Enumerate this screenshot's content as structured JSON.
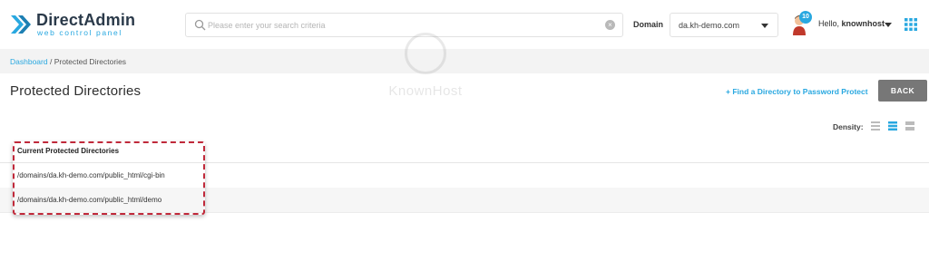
{
  "header": {
    "logo_title": "DirectAdmin",
    "logo_subtitle": "web control panel",
    "search_placeholder": "Please enter your search criteria",
    "domain_label": "Domain",
    "domain_value": "da.kh-demo.com",
    "notification_count": "10",
    "greeting": "Hello,",
    "username": "knownhost"
  },
  "breadcrumb": {
    "home": "Dashboard",
    "separator": " / ",
    "current": "Protected Directories"
  },
  "page": {
    "title": "Protected Directories",
    "find_link": "+ Find a Directory to Password Protect",
    "back_button": "BACK",
    "density_label": "Density:"
  },
  "table": {
    "header": "Current Protected Directories",
    "rows": [
      "/domains/da.kh-demo.com/public_html/cgi-bin",
      "/domains/da.kh-demo.com/public_html/demo"
    ]
  },
  "watermark": {
    "text": "KnownHost"
  },
  "colors": {
    "accent": "#29a8e0",
    "highlight": "#c0293a",
    "back_button": "#777777"
  }
}
